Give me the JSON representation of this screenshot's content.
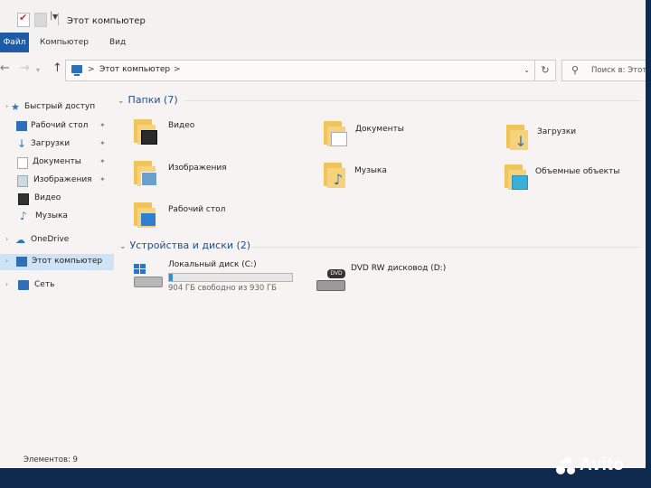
{
  "window": {
    "title": "Этот компьютер"
  },
  "ribbon": {
    "tabs": [
      "Файл",
      "Компьютер",
      "Вид"
    ]
  },
  "address_bar": {
    "path": [
      "Этот компьютер"
    ]
  },
  "search": {
    "placeholder": "Поиск в: Этот компьютер"
  },
  "sidebar": {
    "items": [
      {
        "label": "Быстрый доступ",
        "icon": "star-icon",
        "pinned": false
      },
      {
        "label": "Рабочий стол",
        "icon": "desktop-icon",
        "pinned": true
      },
      {
        "label": "Загрузки",
        "icon": "download-icon",
        "pinned": true
      },
      {
        "label": "Документы",
        "icon": "document-icon",
        "pinned": true
      },
      {
        "label": "Изображения",
        "icon": "image-icon",
        "pinned": true
      },
      {
        "label": "Видео",
        "icon": "video-icon",
        "pinned": false
      },
      {
        "label": "Музыка",
        "icon": "music-icon",
        "pinned": false
      },
      {
        "label": "OneDrive",
        "icon": "cloud-icon",
        "pinned": false
      },
      {
        "label": "Этот компьютер",
        "icon": "computer-icon",
        "pinned": false,
        "selected": true
      },
      {
        "label": "Сеть",
        "icon": "network-icon",
        "pinned": false
      }
    ]
  },
  "main": {
    "folders_group": {
      "header": "Папки (7)",
      "items": [
        {
          "label": "Видео",
          "icon": "video-folder-icon"
        },
        {
          "label": "Документы",
          "icon": "documents-folder-icon"
        },
        {
          "label": "Загрузки",
          "icon": "downloads-folder-icon"
        },
        {
          "label": "Изображения",
          "icon": "pictures-folder-icon"
        },
        {
          "label": "Музыка",
          "icon": "music-folder-icon"
        },
        {
          "label": "Объемные объекты",
          "icon": "3d-objects-folder-icon"
        },
        {
          "label": "Рабочий стол",
          "icon": "desktop-folder-icon"
        }
      ]
    },
    "drives_group": {
      "header": "Устройства и диски (2)",
      "drives": [
        {
          "label": "Локальный диск (C:)",
          "free_text": "904 ГБ свободно из 930 ГБ",
          "used_fraction": 0.028,
          "icon": "hard-drive-icon"
        },
        {
          "label": "DVD RW дисковод (D:)",
          "icon": "dvd-drive-icon",
          "badge": "DVD"
        }
      ]
    }
  },
  "status_bar": {
    "item_count": "Элементов: 9"
  },
  "watermark": {
    "text": "Avito"
  },
  "colors": {
    "accent": "#1d5aa8",
    "group_header": "#1d4f91",
    "selection": "#cfe3f7",
    "folder": "#f1c45a",
    "drive_fill": "#2d8fe0"
  }
}
